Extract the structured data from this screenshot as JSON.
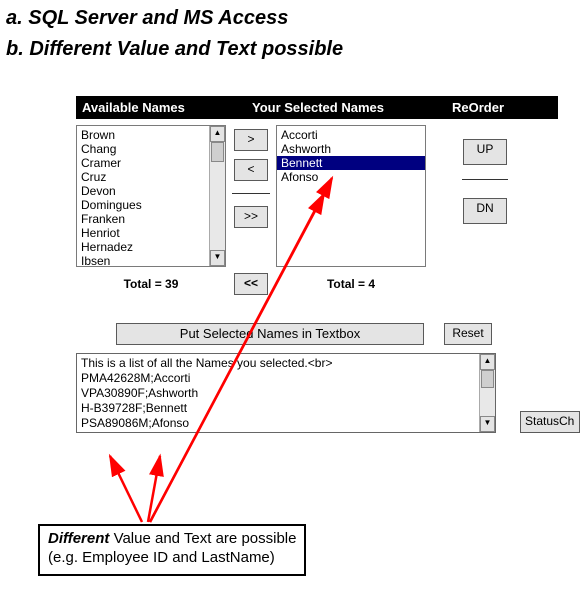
{
  "headings": {
    "a": "a. SQL Server and MS Access",
    "b": "b. Different Value and Text possible"
  },
  "columns": {
    "available": "Available Names",
    "selected": "Your Selected Names",
    "reorder": "ReOrder"
  },
  "available_names": [
    "Brown",
    "Chang",
    "Cramer",
    "Cruz",
    "Devon",
    "Domingues",
    "Franken",
    "Henriot",
    "Hernadez",
    "Ibsen"
  ],
  "selected_names": [
    {
      "label": "Accorti",
      "selected": false
    },
    {
      "label": "Ashworth",
      "selected": false
    },
    {
      "label": "Bennett",
      "selected": true
    },
    {
      "label": "Afonso",
      "selected": false
    }
  ],
  "buttons": {
    "move_right": ">",
    "move_left": "<",
    "move_all_right": ">>",
    "move_all_left": "<<",
    "up": "UP",
    "dn": "DN",
    "put": "Put Selected Names in Textbox",
    "reset": "Reset",
    "status": "StatusCh"
  },
  "totals": {
    "available_label": "Total = 39",
    "selected_label": "Total = 4"
  },
  "textbox_lines": [
    "This is a list of all the Names you selected.<br>",
    "PMA42628M;Accorti",
    "VPA30890F;Ashworth",
    "H-B39728F;Bennett",
    "PSA89086M;Afonso"
  ],
  "annotation": {
    "emph": "Different",
    "rest1": " Value and Text are possible",
    "rest2": "(e.g. Employee ID and LastName)"
  }
}
